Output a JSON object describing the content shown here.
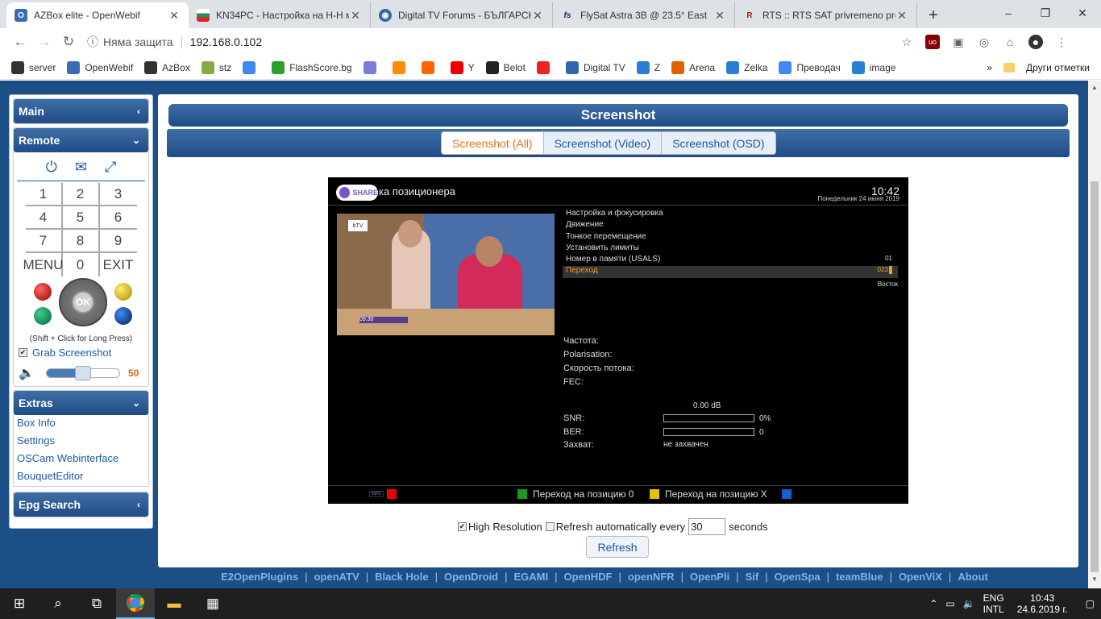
{
  "browser": {
    "tabs": [
      {
        "title": "AZBox elite - OpenWebif",
        "icon": "owif-icon",
        "color": "#3a6cb3",
        "active": true
      },
      {
        "title": "KN34PC - Настройка на H-H м",
        "icon": "bulgaria-flag-icon",
        "color": "#2e8b57"
      },
      {
        "title": "Digital TV Forums - БЪЛГАРСК",
        "icon": "forum-icon",
        "color": "#3366aa"
      },
      {
        "title": "FlySat Astra 3B @ 23.5° East",
        "icon": "flysat-icon",
        "color": "#225"
      },
      {
        "title": "RTS :: RTS SAT privremeno prek",
        "icon": "rts-icon",
        "color": "#a22"
      }
    ],
    "new_tab": "+",
    "window_controls": [
      "–",
      "❐",
      "✕"
    ],
    "address": {
      "security": "Няма защита",
      "url": "192.168.0.102"
    },
    "bookmarks": [
      {
        "label": "server",
        "color": "#333"
      },
      {
        "label": "OpenWebif",
        "color": "#3a6cb3"
      },
      {
        "label": "AzBox",
        "color": "#333"
      },
      {
        "label": "stz",
        "color": "#8a4"
      },
      {
        "label": "",
        "color": "#4285f4"
      },
      {
        "label": "FlashScore.bg",
        "color": "#2e9e2e"
      },
      {
        "label": "",
        "color": "#7b7bdb"
      },
      {
        "label": "",
        "color": "#ff8c00"
      },
      {
        "label": "",
        "color": "#f60"
      },
      {
        "label": "Y",
        "color": "#e00"
      },
      {
        "label": "Belot",
        "color": "#222"
      },
      {
        "label": "",
        "color": "#e22"
      },
      {
        "label": "Digital TV",
        "color": "#3366aa"
      },
      {
        "label": "Z",
        "color": "#2a7ed3"
      },
      {
        "label": "Arena",
        "color": "#e06000"
      },
      {
        "label": "Zelka",
        "color": "#2a7ed3"
      },
      {
        "label": "Преводач",
        "color": "#4285f4"
      },
      {
        "label": "image",
        "color": "#2a7ed3"
      }
    ],
    "bookmarks_more": "»",
    "other_bookmarks": "Други отметки"
  },
  "sidebar": {
    "main": "Main",
    "remote": "Remote",
    "keypad": [
      "1",
      "2",
      "3",
      "4",
      "5",
      "6",
      "7",
      "8",
      "9",
      "MENU",
      "0",
      "EXIT"
    ],
    "ok": "OK",
    "shift_hint": "(Shift + Click for Long Press)",
    "grab_label": "Grab Screenshot",
    "grab_checked": "✔",
    "volume": 50,
    "volume_label": "50",
    "extras": "Extras",
    "extras_items": [
      "Box Info",
      "Settings",
      "OSCam Webinterface",
      "BouquetEditor"
    ],
    "epg": "Epg Search"
  },
  "main": {
    "title": "Screenshot",
    "tabs": [
      "Screenshot (All)",
      "Screenshot (Video)",
      "Screenshot (OSD)"
    ],
    "selected_tab": 0,
    "screenshot": {
      "share": "SHARE",
      "title": "ка позиционера",
      "time": "10:42",
      "date": "Понедельник 24 июня 2019",
      "menu": [
        {
          "label": "Настройка и фокусировка",
          "value": ""
        },
        {
          "label": "Движение",
          "value": ""
        },
        {
          "label": "Тонкое перемещение",
          "value": ""
        },
        {
          "label": "Установить лимиты",
          "value": ""
        },
        {
          "label": "Номер в памяти (USALS)",
          "value": "01"
        },
        {
          "label": "Переход",
          "value": "023"
        }
      ],
      "direction": "Восток",
      "pip_logo": "bTV",
      "pip_time": "09:30",
      "labels": {
        "freq": "Частота:",
        "pol": "Polarisation:",
        "rate": "Скорость потока:",
        "fec": "FEC:"
      },
      "db": "0.00 dB",
      "snr_label": "SNR:",
      "snr": 0,
      "snr_value": "0%",
      "ber_label": "BER:",
      "ber": 0,
      "ber_value": "0",
      "lock_label": "Захват:",
      "lock_value": "не захвачен",
      "info": "INFO",
      "footer_green": "Переход на позицию 0",
      "footer_yellow": "Переход на позицию X"
    },
    "high_res": "High Resolution",
    "high_res_checked": "✔",
    "refresh_auto": "Refresh automatically every",
    "refresh_seconds": "30",
    "seconds": "seconds",
    "refresh_button": "Refresh"
  },
  "footer_links": [
    "E2OpenPlugins",
    "openATV",
    "Black Hole",
    "OpenDroid",
    "EGAMI",
    "OpenHDF",
    "openNFR",
    "OpenPli",
    "Sif",
    "OpenSpa",
    "teamBlue",
    "OpenViX",
    "About"
  ],
  "taskbar": {
    "lang": "ENG",
    "layout": "INTL",
    "time": "10:43",
    "date": "24.6.2019 г."
  }
}
